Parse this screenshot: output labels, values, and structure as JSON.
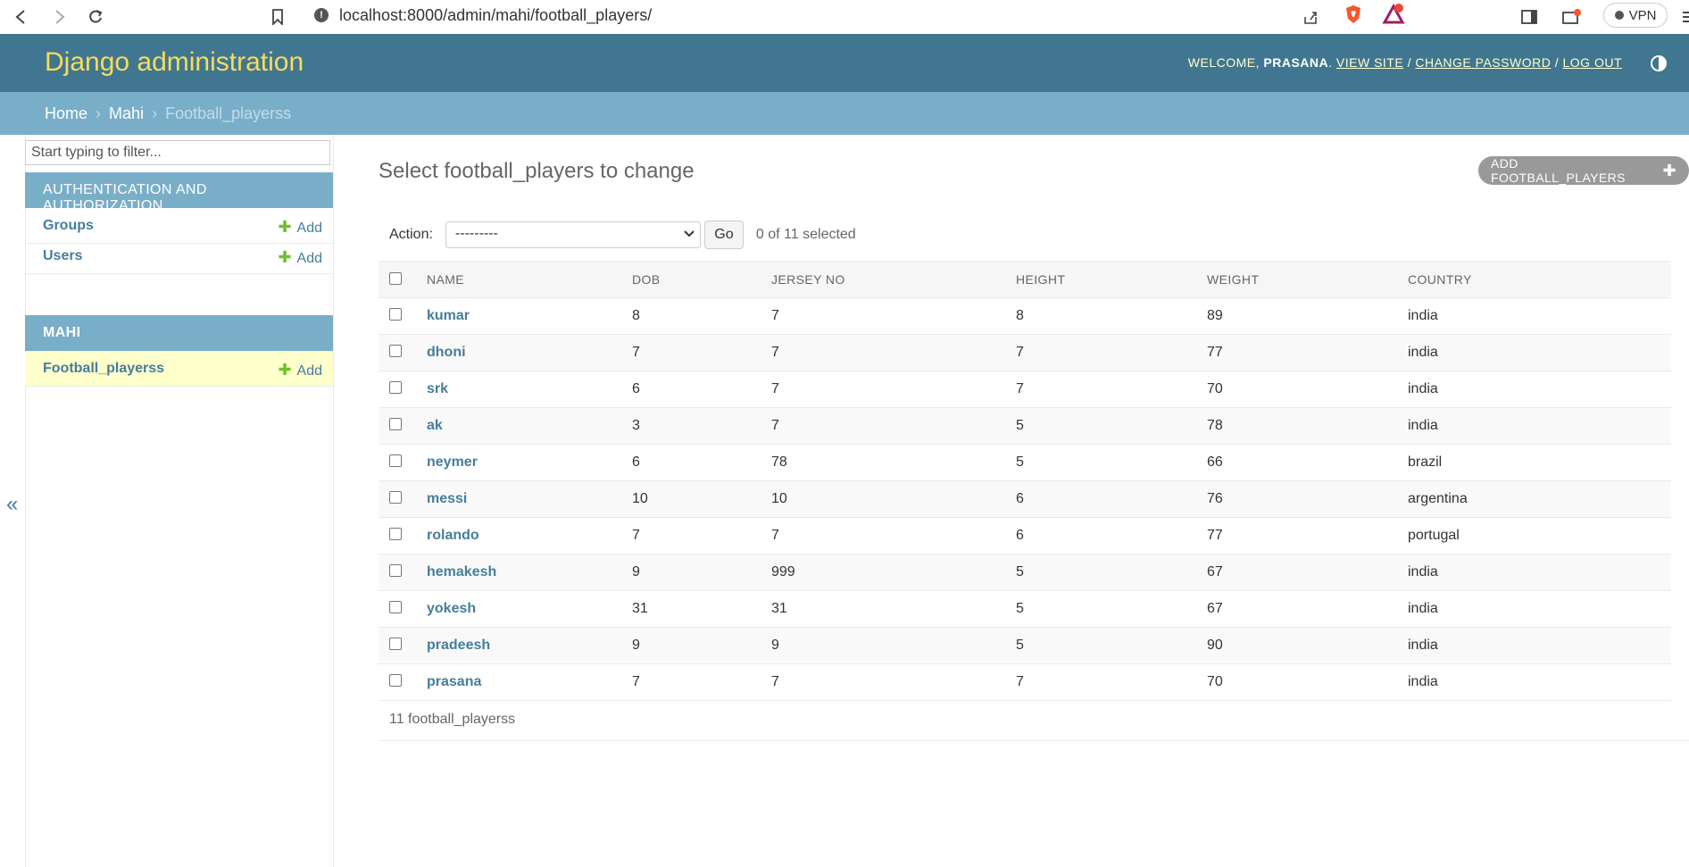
{
  "browser": {
    "url": "localhost:8000/admin/mahi/football_players/",
    "vpn_label": "VPN",
    "notification_count": "1"
  },
  "header": {
    "brand": "Django administration",
    "welcome": "WELCOME,",
    "username": "PRASANA",
    "view_site": "VIEW SITE",
    "change_password": "CHANGE PASSWORD",
    "log_out": "LOG OUT",
    "separator": "/"
  },
  "breadcrumbs": {
    "home": "Home",
    "app": "Mahi",
    "current": "Football_playerss",
    "sep": "›"
  },
  "sidebar": {
    "filter_placeholder": "Start typing to filter...",
    "collapse_label": "«",
    "apps": [
      {
        "caption": "AUTHENTICATION AND AUTHORIZATION",
        "models": [
          {
            "name": "Groups",
            "add": "Add"
          },
          {
            "name": "Users",
            "add": "Add"
          }
        ]
      },
      {
        "caption": "MAHI",
        "models": [
          {
            "name": "Football_playerss",
            "add": "Add"
          }
        ]
      }
    ]
  },
  "main": {
    "title": "Select football_players to change",
    "add_button": "ADD FOOTBALL_PLAYERS",
    "actions": {
      "label": "Action:",
      "selected_option": "---------",
      "go": "Go",
      "selection_count": "0 of 11 selected"
    },
    "table": {
      "headers": [
        "NAME",
        "DOB",
        "JERSEY NO",
        "HEIGHT",
        "WEIGHT",
        "COUNTRY"
      ],
      "rows": [
        [
          "kumar",
          "8",
          "7",
          "8",
          "89",
          "india"
        ],
        [
          "dhoni",
          "7",
          "7",
          "7",
          "77",
          "india"
        ],
        [
          "srk",
          "6",
          "7",
          "7",
          "70",
          "india"
        ],
        [
          "ak",
          "3",
          "7",
          "5",
          "78",
          "india"
        ],
        [
          "neymer",
          "6",
          "78",
          "5",
          "66",
          "brazil"
        ],
        [
          "messi",
          "10",
          "10",
          "6",
          "76",
          "argentina"
        ],
        [
          "rolando",
          "7",
          "7",
          "6",
          "77",
          "portugal"
        ],
        [
          "hemakesh",
          "9",
          "999",
          "5",
          "67",
          "india"
        ],
        [
          "yokesh",
          "31",
          "31",
          "5",
          "67",
          "india"
        ],
        [
          "pradeesh",
          "9",
          "9",
          "5",
          "90",
          "india"
        ],
        [
          "prasana",
          "7",
          "7",
          "7",
          "70",
          "india"
        ]
      ]
    },
    "paginator": "11 football_playerss"
  },
  "colors": {
    "header_bg": "#417690",
    "brand": "#f5dd5d",
    "breadcrumb_bg": "#79aec8",
    "link": "#447e9b",
    "add_plus": "#70bf2b",
    "selected_row": "#ffffcc"
  }
}
